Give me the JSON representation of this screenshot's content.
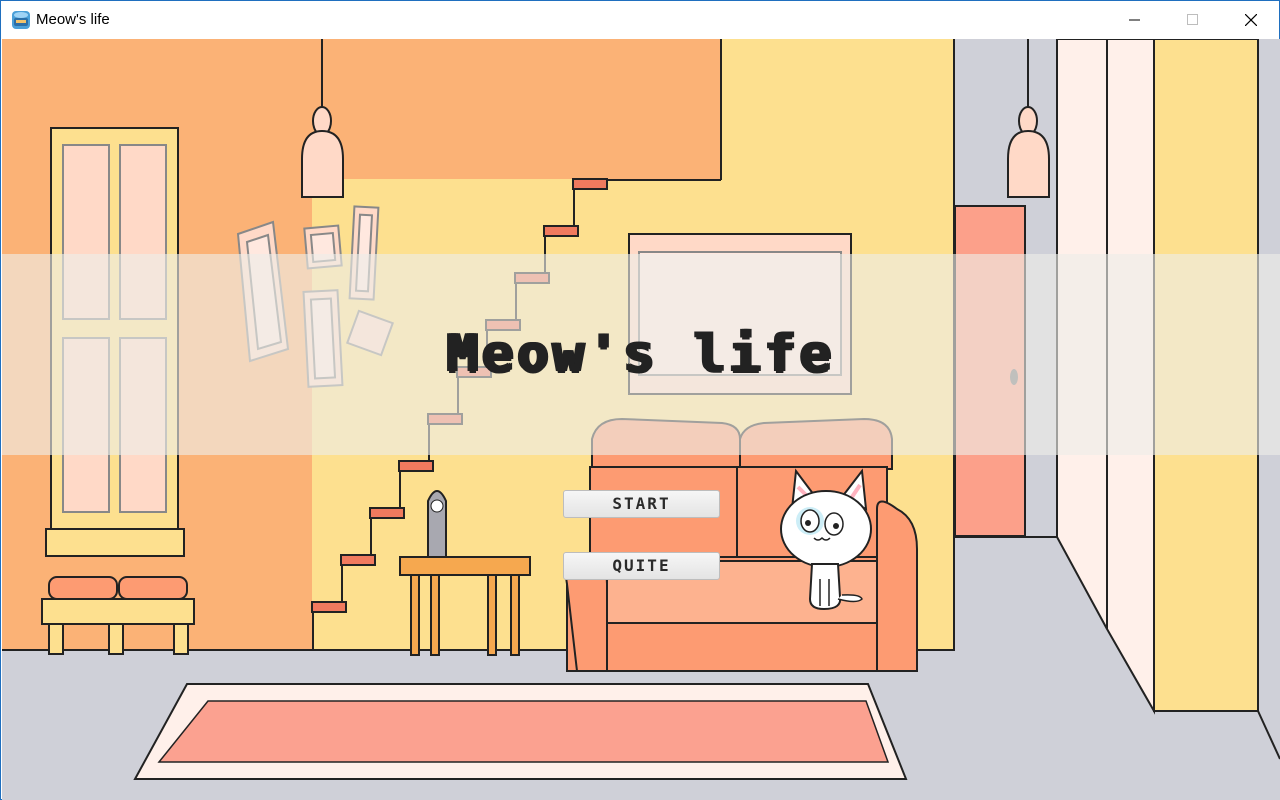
{
  "window": {
    "title": "Meow's life",
    "controls": [
      "minimize",
      "maximize",
      "close"
    ]
  },
  "game": {
    "title": "Meow's life",
    "menu": {
      "start_label": "START",
      "quit_label": "QUITE"
    }
  },
  "colors": {
    "wall_orange": "#fbb276",
    "wall_yellow": "#fde08f",
    "floor_gray": "#cfd0d8",
    "sofa": "#fd9b72",
    "rug": "#fba190"
  }
}
